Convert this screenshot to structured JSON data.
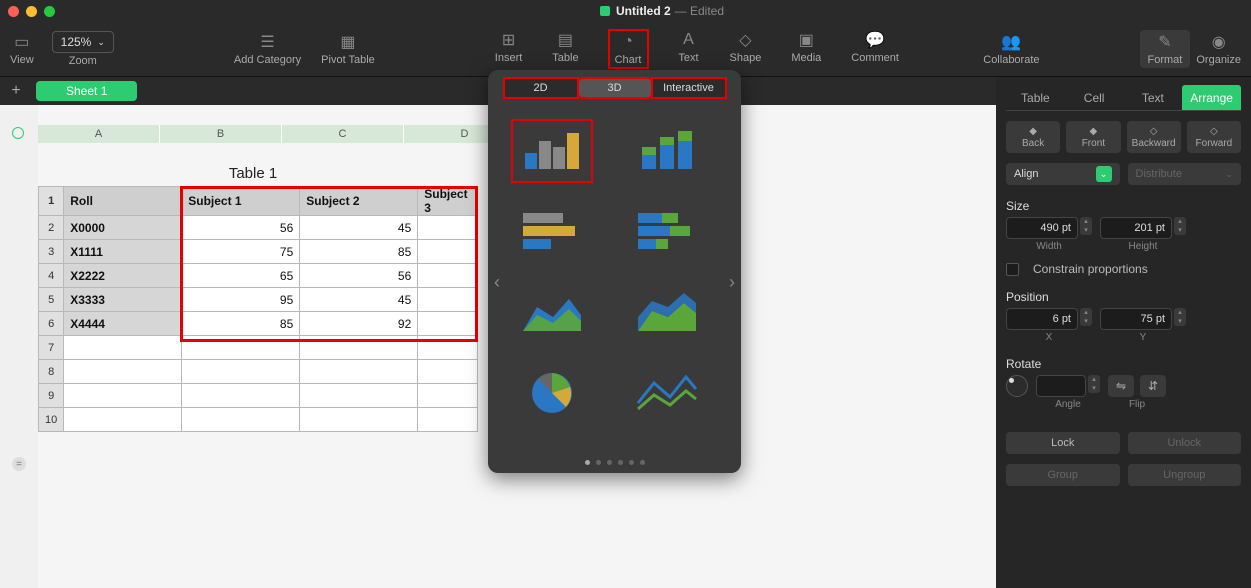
{
  "window": {
    "title": "Untitled 2",
    "status": "— Edited"
  },
  "toolbar": {
    "view": "View",
    "zoom_value": "125%",
    "zoom_label": "Zoom",
    "add_category": "Add Category",
    "pivot_table": "Pivot Table",
    "insert": "Insert",
    "table": "Table",
    "chart": "Chart",
    "text": "Text",
    "shape": "Shape",
    "media": "Media",
    "comment": "Comment",
    "collaborate": "Collaborate",
    "format": "Format",
    "organize": "Organize"
  },
  "sheet_tab": "Sheet 1",
  "columns": [
    "A",
    "B",
    "C",
    "D"
  ],
  "table": {
    "title": "Table 1",
    "headers": [
      "Roll",
      "Subject 1",
      "Subject 2",
      "Subject 3"
    ],
    "rows": [
      {
        "n": "1"
      },
      {
        "n": "2",
        "roll": "X0000",
        "s1": "56",
        "s2": "45",
        "s3": ""
      },
      {
        "n": "3",
        "roll": "X1111",
        "s1": "75",
        "s2": "85",
        "s3": ""
      },
      {
        "n": "4",
        "roll": "X2222",
        "s1": "65",
        "s2": "56",
        "s3": ""
      },
      {
        "n": "5",
        "roll": "X3333",
        "s1": "95",
        "s2": "45",
        "s3": ""
      },
      {
        "n": "6",
        "roll": "X4444",
        "s1": "85",
        "s2": "92",
        "s3": ""
      },
      {
        "n": "7"
      },
      {
        "n": "8"
      },
      {
        "n": "9"
      },
      {
        "n": "10"
      }
    ]
  },
  "chart_popover": {
    "tabs": [
      "2D",
      "3D",
      "Interactive"
    ],
    "selected_tab": "3D"
  },
  "inspector": {
    "tabs": [
      "Table",
      "Cell",
      "Text",
      "Arrange"
    ],
    "selected": "Arrange",
    "layer": {
      "back": "Back",
      "front": "Front",
      "backward": "Backward",
      "forward": "Forward"
    },
    "align": "Align",
    "distribute": "Distribute",
    "size_label": "Size",
    "width_value": "490 pt",
    "width_label": "Width",
    "height_value": "201 pt",
    "height_label": "Height",
    "constrain": "Constrain proportions",
    "position_label": "Position",
    "x_value": "6 pt",
    "x_label": "X",
    "y_value": "75 pt",
    "y_label": "Y",
    "rotate_label": "Rotate",
    "angle_label": "Angle",
    "flip_label": "Flip",
    "lock": "Lock",
    "unlock": "Unlock",
    "group": "Group",
    "ungroup": "Ungroup"
  }
}
